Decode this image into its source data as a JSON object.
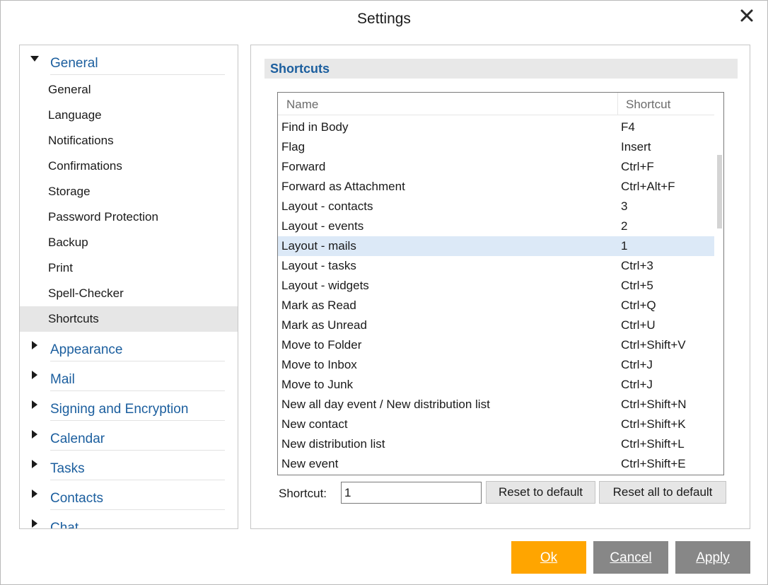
{
  "window": {
    "title": "Settings"
  },
  "sidebar": {
    "expanded_group": {
      "label": "General",
      "items": [
        "General",
        "Language",
        "Notifications",
        "Confirmations",
        "Storage",
        "Password Protection",
        "Backup",
        "Print",
        "Spell-Checker",
        "Shortcuts"
      ],
      "selected": "Shortcuts"
    },
    "collapsed_groups": [
      "Appearance",
      "Mail",
      "Signing and Encryption",
      "Calendar",
      "Tasks",
      "Contacts",
      "Chat"
    ]
  },
  "section": {
    "title": "Shortcuts"
  },
  "table": {
    "columns": {
      "name": "Name",
      "shortcut": "Shortcut"
    },
    "rows": [
      {
        "name": "Find in Body",
        "shortcut": "F4"
      },
      {
        "name": "Flag",
        "shortcut": "Insert"
      },
      {
        "name": "Forward",
        "shortcut": "Ctrl+F"
      },
      {
        "name": "Forward as Attachment",
        "shortcut": "Ctrl+Alt+F"
      },
      {
        "name": "Layout - contacts",
        "shortcut": "3"
      },
      {
        "name": "Layout - events",
        "shortcut": "2"
      },
      {
        "name": "Layout - mails",
        "shortcut": "1"
      },
      {
        "name": "Layout - tasks",
        "shortcut": "Ctrl+3"
      },
      {
        "name": "Layout - widgets",
        "shortcut": "Ctrl+5"
      },
      {
        "name": "Mark as Read",
        "shortcut": "Ctrl+Q"
      },
      {
        "name": "Mark as Unread",
        "shortcut": "Ctrl+U"
      },
      {
        "name": "Move to Folder",
        "shortcut": "Ctrl+Shift+V"
      },
      {
        "name": "Move to Inbox",
        "shortcut": "Ctrl+J"
      },
      {
        "name": "Move to Junk",
        "shortcut": "Ctrl+J"
      },
      {
        "name": "New all day event / New distribution list",
        "shortcut": "Ctrl+Shift+N"
      },
      {
        "name": "New contact",
        "shortcut": "Ctrl+Shift+K"
      },
      {
        "name": "New distribution list",
        "shortcut": "Ctrl+Shift+L"
      },
      {
        "name": "New event",
        "shortcut": "Ctrl+Shift+E"
      }
    ],
    "selected_row_index": 6
  },
  "editor": {
    "label": "Shortcut:",
    "value": "1",
    "reset_label": "Reset to default",
    "reset_all_label": "Reset all to default"
  },
  "footer": {
    "ok_label": "Ok",
    "cancel_label": "Cancel",
    "apply_label": "Apply"
  },
  "colors": {
    "accent": "#1b5e9e",
    "ok_button": "#ffa500",
    "secondary_button": "#878787",
    "selected_row": "#dce9f7",
    "selected_nav": "#e6e6e6"
  },
  "icons": {
    "close": "close-icon",
    "expanded": "triangle-down-icon",
    "collapsed": "triangle-right-icon"
  }
}
